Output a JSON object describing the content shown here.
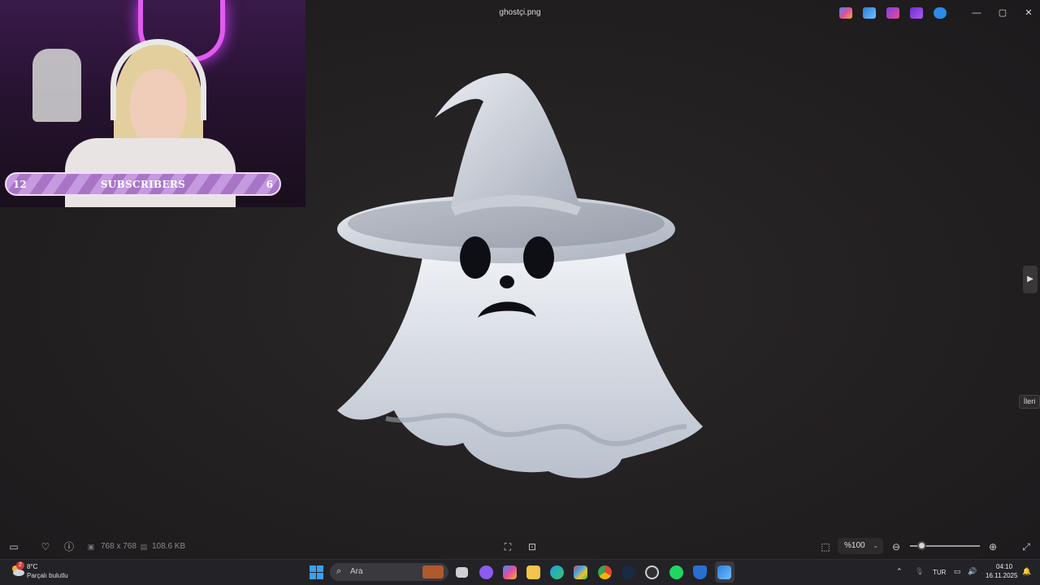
{
  "window": {
    "title": "ghostçi.png",
    "controls": {
      "minimize": "—",
      "maximize": "▢",
      "close": "✕"
    }
  },
  "title_bar_apps": [
    "copilot-icon",
    "photos-icon",
    "clipchamp-icon",
    "video-editor-icon",
    "onedrive-icon"
  ],
  "overlay": {
    "left_count": "12",
    "label": "SUBSCRIBERS",
    "right_count": "6"
  },
  "viewer": {
    "next_tooltip": "İleri",
    "next_arrow": "▶"
  },
  "status_bar": {
    "dimensions": "768 x 768",
    "file_size": "108.6 KB",
    "zoom_value": "%100",
    "zoom_level": 0.1
  },
  "taskbar": {
    "weather": {
      "badge": "2",
      "temperature": "8°C",
      "description": "Parçalı bulutlu"
    },
    "search_placeholder": "Ara",
    "apps": [
      "file-view-icon",
      "discord-icon",
      "copilot-icon",
      "file-explorer-icon",
      "edge-icon",
      "store-icon",
      "chrome-icon",
      "steam-icon",
      "obs-icon",
      "spotify-icon",
      "shield-icon",
      "photos-icon"
    ],
    "tray": {
      "language": "TUR",
      "time": "04:10",
      "date": "16.11.2025"
    }
  },
  "colors": {
    "accent": "#3aa0f0",
    "overlay_purple": "#b07fd0",
    "neon": "#e25bf0",
    "background": "#232021"
  }
}
